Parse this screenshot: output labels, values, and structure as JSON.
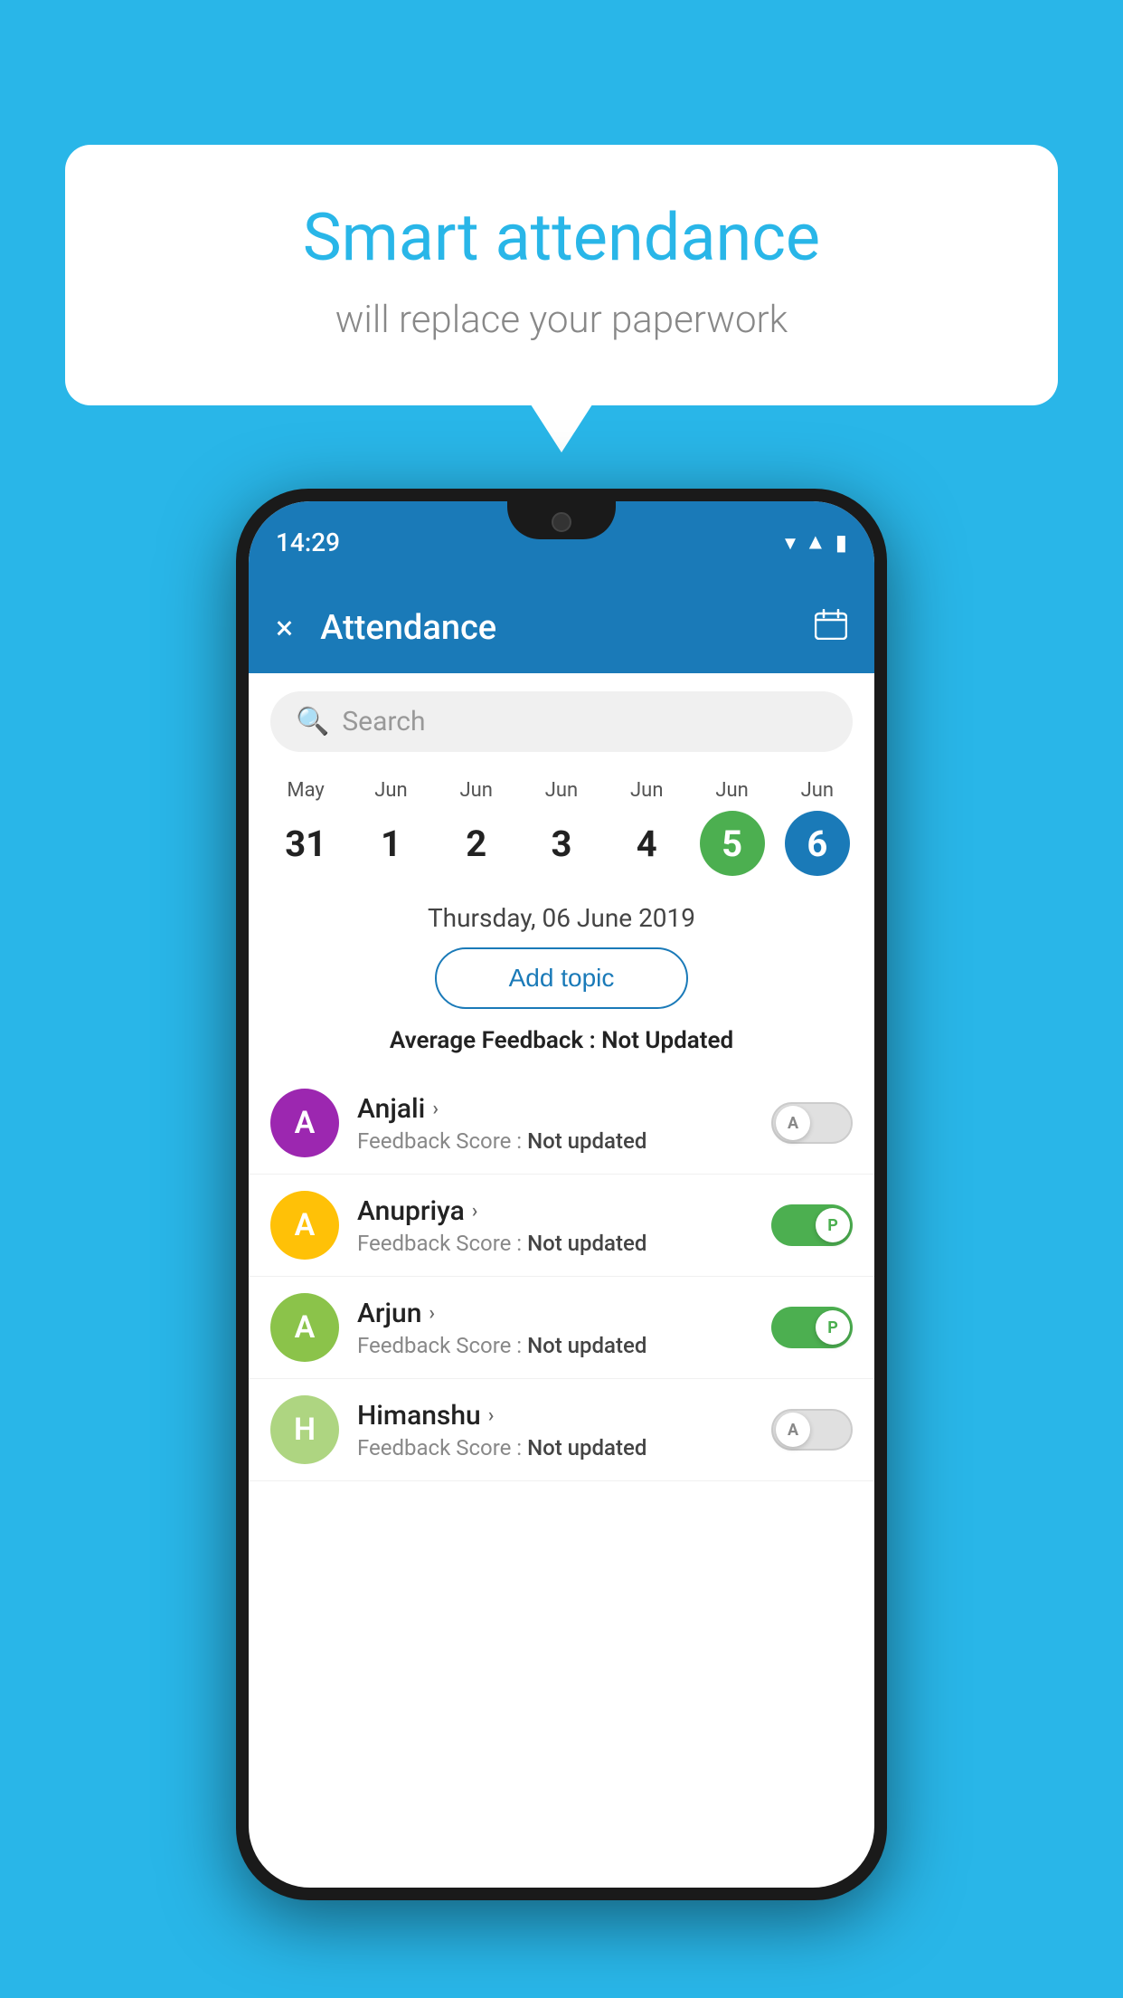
{
  "background_color": "#29b6e8",
  "speech_bubble": {
    "title": "Smart attendance",
    "subtitle": "will replace your paperwork"
  },
  "phone": {
    "status_bar": {
      "time": "14:29",
      "icons": [
        "wifi",
        "signal",
        "battery"
      ]
    },
    "header": {
      "title": "Attendance",
      "close_label": "×",
      "calendar_icon": "📅"
    },
    "search": {
      "placeholder": "Search"
    },
    "calendar": {
      "days": [
        {
          "month": "May",
          "date": "31",
          "state": "normal"
        },
        {
          "month": "Jun",
          "date": "1",
          "state": "normal"
        },
        {
          "month": "Jun",
          "date": "2",
          "state": "normal"
        },
        {
          "month": "Jun",
          "date": "3",
          "state": "normal"
        },
        {
          "month": "Jun",
          "date": "4",
          "state": "normal"
        },
        {
          "month": "Jun",
          "date": "5",
          "state": "today"
        },
        {
          "month": "Jun",
          "date": "6",
          "state": "selected"
        }
      ]
    },
    "selected_date": "Thursday, 06 June 2019",
    "add_topic_label": "Add topic",
    "avg_feedback_label": "Average Feedback :",
    "avg_feedback_value": "Not Updated",
    "students": [
      {
        "name": "Anjali",
        "avatar_letter": "A",
        "avatar_color": "#9c27b0",
        "feedback_label": "Feedback Score :",
        "feedback_value": "Not updated",
        "attendance": "absent",
        "toggle_label": "A"
      },
      {
        "name": "Anupriya",
        "avatar_letter": "A",
        "avatar_color": "#ffc107",
        "feedback_label": "Feedback Score :",
        "feedback_value": "Not updated",
        "attendance": "present",
        "toggle_label": "P"
      },
      {
        "name": "Arjun",
        "avatar_letter": "A",
        "avatar_color": "#8bc34a",
        "feedback_label": "Feedback Score :",
        "feedback_value": "Not updated",
        "attendance": "present",
        "toggle_label": "P"
      },
      {
        "name": "Himanshu",
        "avatar_letter": "H",
        "avatar_color": "#aed581",
        "feedback_label": "Feedback Score :",
        "feedback_value": "Not updated",
        "attendance": "absent",
        "toggle_label": "A"
      }
    ]
  }
}
